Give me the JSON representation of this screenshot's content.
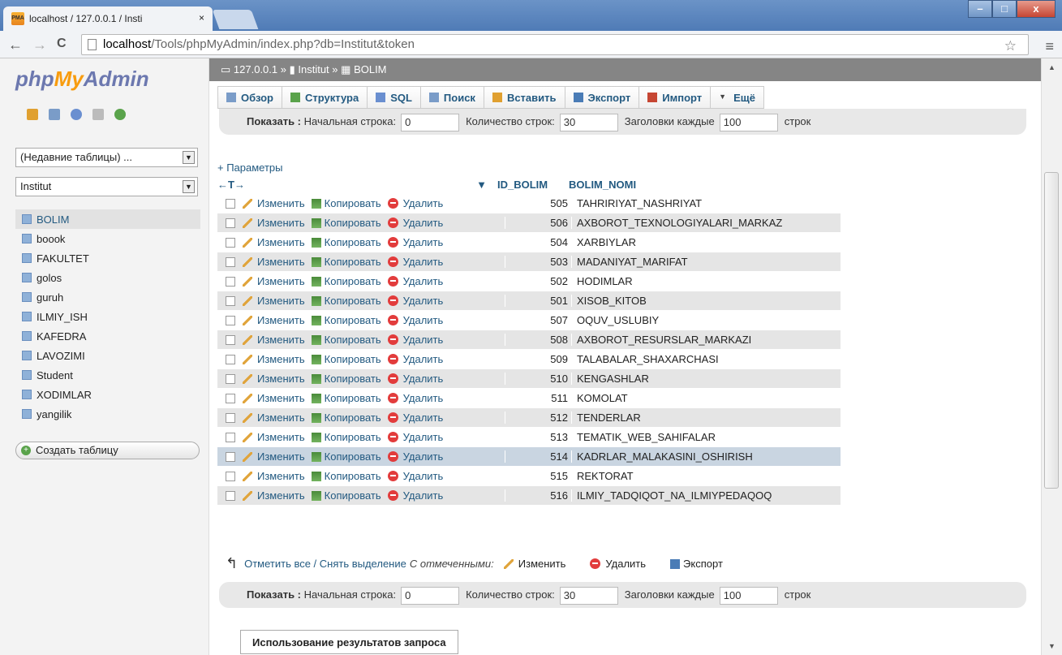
{
  "browser": {
    "tab_title": "localhost / 127.0.0.1 / Insti",
    "tab_close": "×",
    "favicon_text": "PMA",
    "url_domain": "localhost",
    "url_path": "/Tools/phpMyAdmin/index.php?db=Institut&token",
    "back": "←",
    "forward": "→",
    "reload": "C",
    "star": "☆",
    "menu": "≡",
    "win_min": "–",
    "win_max": "□",
    "win_close": "x"
  },
  "sidebar": {
    "logo_php": "php",
    "logo_my": "My",
    "logo_admin": "Admin",
    "recent": "(Недавние таблицы) ...",
    "database": "Institut",
    "tables": [
      "BOLIM",
      "boook",
      "FAKULTET",
      "golos",
      "guruh",
      "ILMIY_ISH",
      "KAFEDRA",
      "LAVOZIMI",
      "Student",
      "XODIMLAR",
      "yangilik"
    ],
    "create_table": "Создать таблицу"
  },
  "breadcrumb": {
    "server": "127.0.0.1",
    "db": "Institut",
    "table": "BOLIM",
    "sep": "»"
  },
  "tabs": [
    "Обзор",
    "Структура",
    "SQL",
    "Поиск",
    "Вставить",
    "Экспорт",
    "Импорт",
    "Ещё"
  ],
  "showbar": {
    "label": "Показать :",
    "start_label": "Начальная строка:",
    "start_value": "0",
    "rows_label": "Количество строк:",
    "rows_value": "30",
    "headers_label": "Заголовки каждые",
    "headers_value": "100",
    "rows_suffix": "строк"
  },
  "params": "+ Параметры",
  "table": {
    "arrows": "←T→",
    "sort_icon": "▼",
    "columns": [
      "ID_BOLIM",
      "BOLIM_NOMI"
    ],
    "edit": "Изменить",
    "copy": "Копировать",
    "delete": "Удалить",
    "rows": [
      [
        "505",
        "TAHRIRIYAT_NASHRIYAT"
      ],
      [
        "506",
        "AXBOROT_TEXNOLOGIYALARI_MARKAZ"
      ],
      [
        "504",
        "XARBIYLAR"
      ],
      [
        "503",
        "MADANIYAT_MARIFAT"
      ],
      [
        "502",
        "HODIMLAR"
      ],
      [
        "501",
        "XISOB_KITOB"
      ],
      [
        "507",
        "OQUV_USLUBIY"
      ],
      [
        "508",
        "AXBOROT_RESURSLAR_MARKAZI"
      ],
      [
        "509",
        "TALABALAR_SHAXARCHASI"
      ],
      [
        "510",
        "KENGASHLAR"
      ],
      [
        "511",
        "KOMOLAT"
      ],
      [
        "512",
        "TENDERLAR"
      ],
      [
        "513",
        "TEMATIK_WEB_SAHIFALAR"
      ],
      [
        "514",
        "KADRLAR_MALAKASINI_OSHIRISH"
      ],
      [
        "515",
        "REKTORAT"
      ],
      [
        "516",
        "ILMIY_TADQIQOT_NA_ILMIYPEDAQOQ"
      ]
    ],
    "highlighted_row": 13
  },
  "bulk": {
    "check_all": "Отметить все / Снять выделение",
    "with_selected": "С отмеченными:",
    "edit": "Изменить",
    "delete": "Удалить",
    "export": "Экспорт"
  },
  "query_results": "Использование результатов запроса"
}
